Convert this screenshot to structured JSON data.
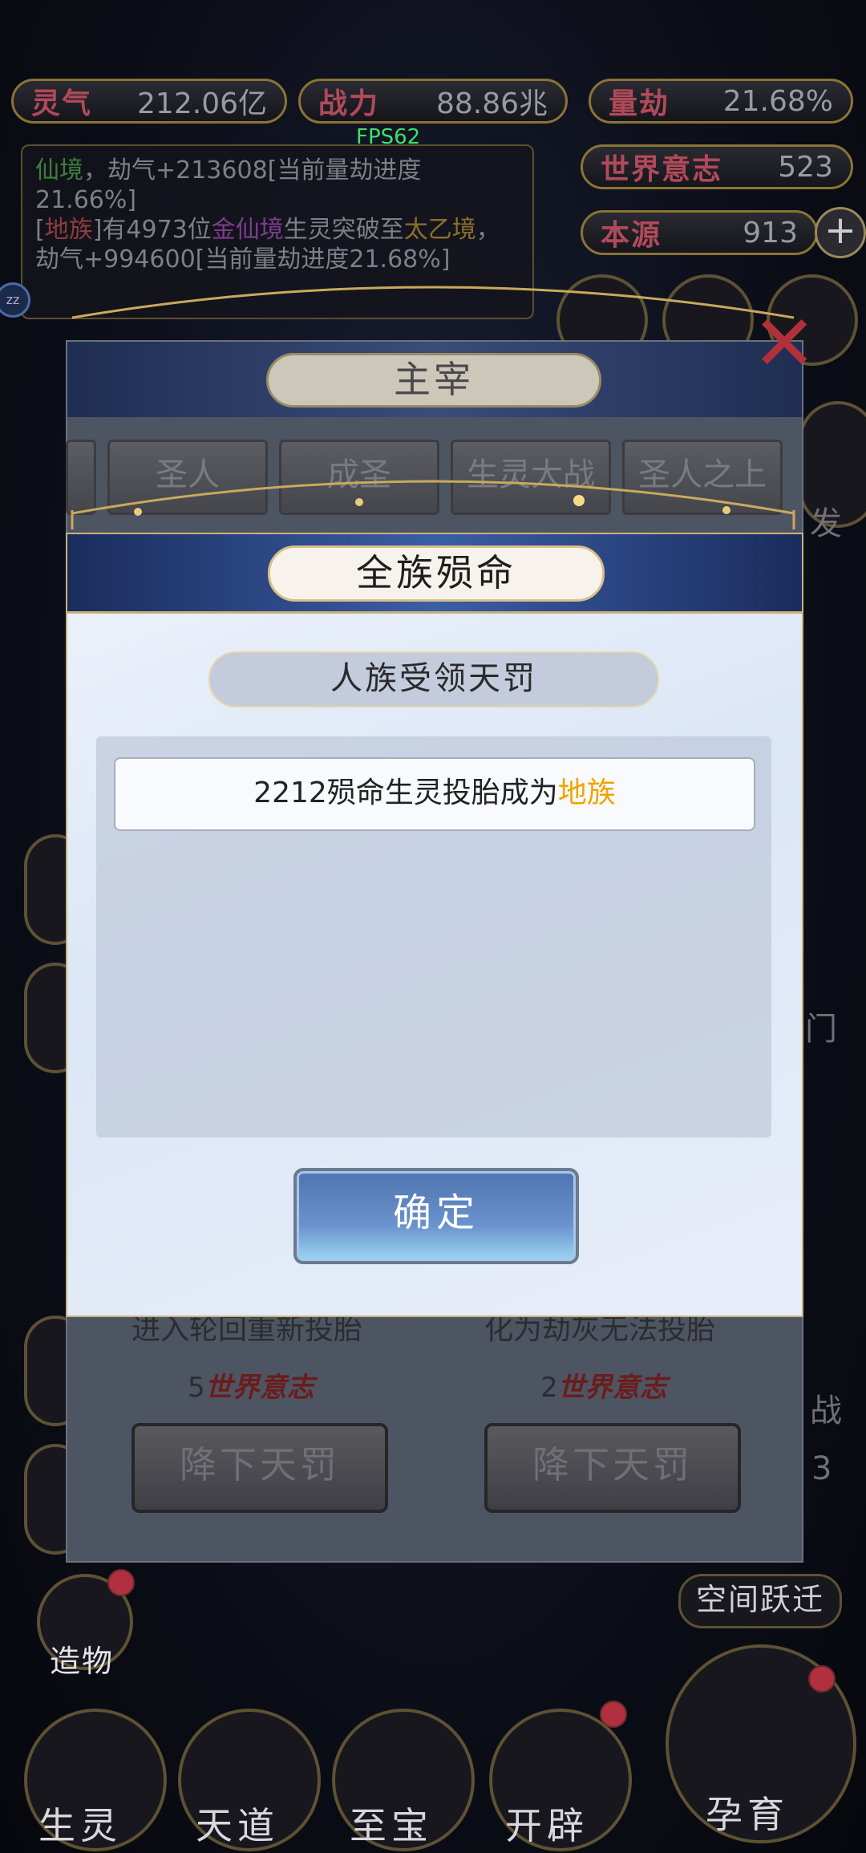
{
  "fps": "FPS62",
  "top_stats": [
    {
      "key": "灵气",
      "value": "212.06亿"
    },
    {
      "key": "战力",
      "value": "88.86兆"
    },
    {
      "key": "量劫",
      "value": "21.68%"
    },
    {
      "key": "世界意志",
      "value": "523"
    },
    {
      "key": "本源",
      "value": "913"
    }
  ],
  "plus_label": "+",
  "side_badge": "zz",
  "log": {
    "line1_a": "仙境",
    "line1_b": "，劫气+213608[当前量劫进度21.66%]",
    "line2_a": "[",
    "line2_race": "地族",
    "line2_b": "]有4973位",
    "line2_realm": "金仙境",
    "line2_c": "生灵突破至",
    "line2_target": "太乙境",
    "line2_d": "，劫气+994600[当前量劫进度21.68%]"
  },
  "back_modal": {
    "title": "主宰",
    "tabs": [
      "圣人",
      "成圣",
      "生灵大战",
      "圣人之上"
    ],
    "left_desc": "进入轮回重新投胎",
    "left_cost_num": "5",
    "left_cost_unit": "世界意志",
    "right_desc": "化为劫灰无法投胎",
    "right_cost_num": "2",
    "right_cost_unit": "世界意志",
    "left_button": "降下天罚",
    "right_button": "降下天罚"
  },
  "front_modal": {
    "title": "全族殒命",
    "subtitle": "人族受领天罚",
    "message_prefix": "2212殒命生灵投胎成为",
    "message_highlight": "地族",
    "confirm_button": "确定"
  },
  "side_labels": {
    "right_fa": "发",
    "right_men": "门",
    "right_zhan": "战",
    "right_3": "3",
    "space_jump": "空间跃迁",
    "zaowu": "造物"
  },
  "bottom_nav": [
    "生灵",
    "天道",
    "至宝",
    "开辟",
    "孕育"
  ],
  "colors": {
    "accent_gold": "#c9b27a",
    "highlight_orange": "#f0a400",
    "fps_green": "#3fe06a",
    "confirm_blue": "#5b82c0"
  }
}
